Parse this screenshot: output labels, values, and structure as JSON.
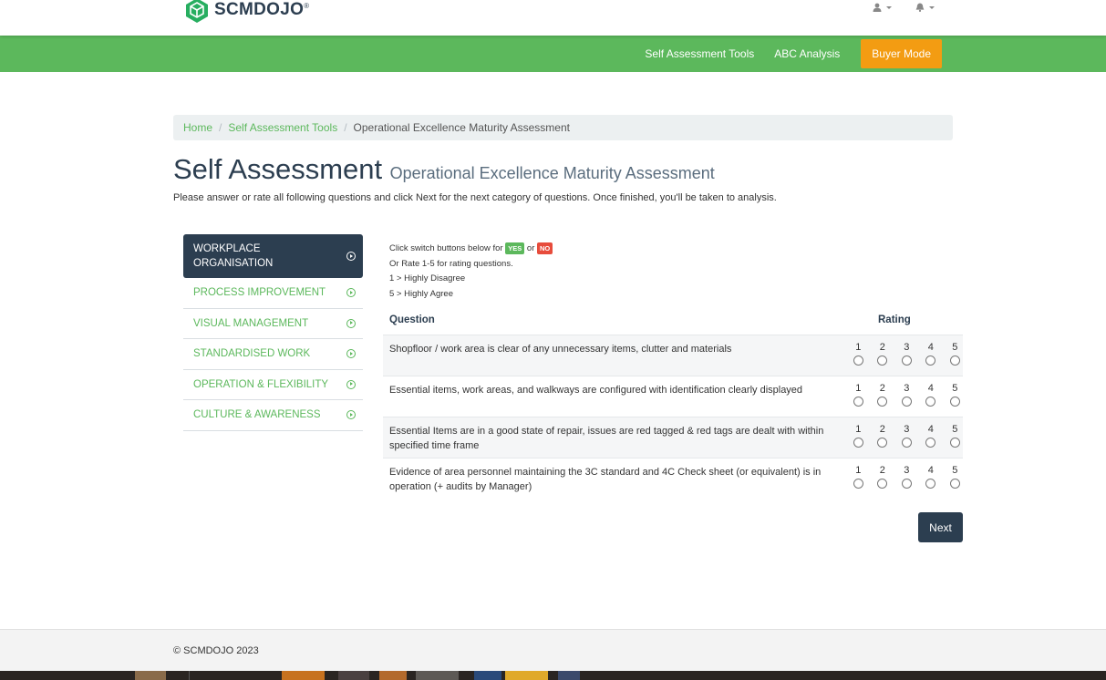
{
  "brand": {
    "name": "SCMDOJO",
    "mark": "®"
  },
  "header": {
    "user_icon": "user-icon",
    "bell_icon": "bell-icon"
  },
  "nav": {
    "links": [
      "Self Assessment Tools",
      "ABC Analysis"
    ],
    "buyer_mode": "Buyer Mode"
  },
  "breadcrumb": {
    "home": "Home",
    "tools": "Self Assessment Tools",
    "current": "Operational Excellence Maturity Assessment",
    "separator": "/"
  },
  "page": {
    "title": "Self Assessment",
    "subtitle": "Operational Excellence Maturity Assessment",
    "intro": "Please answer or rate all following questions and click Next for the next category of questions. Once finished, you'll be taken to analysis."
  },
  "sidebar": {
    "active": "WORKPLACE ORGANISATION",
    "items": [
      "PROCESS IMPROVEMENT",
      "VISUAL MANAGEMENT",
      "STANDARDISED WORK",
      "OPERATION & FLEXIBILITY",
      "CULTURE & AWARENESS"
    ]
  },
  "instructions": {
    "line1_prefix": "Click switch buttons below for",
    "yes": "YES",
    "or": "or",
    "no": "NO",
    "line2": "Or Rate 1-5 for rating questions.",
    "line3": "1 > Highly Disagree",
    "line4": "5 > Highly Agree"
  },
  "table": {
    "col_question": "Question",
    "col_rating": "Rating",
    "scale": [
      "1",
      "2",
      "3",
      "4",
      "5"
    ],
    "questions": [
      "Shopfloor / work area is clear of any unnecessary items, clutter and materials",
      "Essential items, work areas, and walkways are configured with identification clearly displayed",
      "Essential Items are in a good state of repair, issues are red tagged & red tags are dealt with within specified time frame",
      "Evidence of area personnel maintaining the 3C standard and 4C Check sheet (or equivalent) is in operation (+ audits by Manager)"
    ]
  },
  "actions": {
    "next": "Next"
  },
  "footer": {
    "copyright": "© SCMDOJO 2023"
  },
  "colors": {
    "green": "#5cb85c",
    "navy": "#2c3e50",
    "orange": "#f39c12",
    "red": "#e74c3c"
  }
}
